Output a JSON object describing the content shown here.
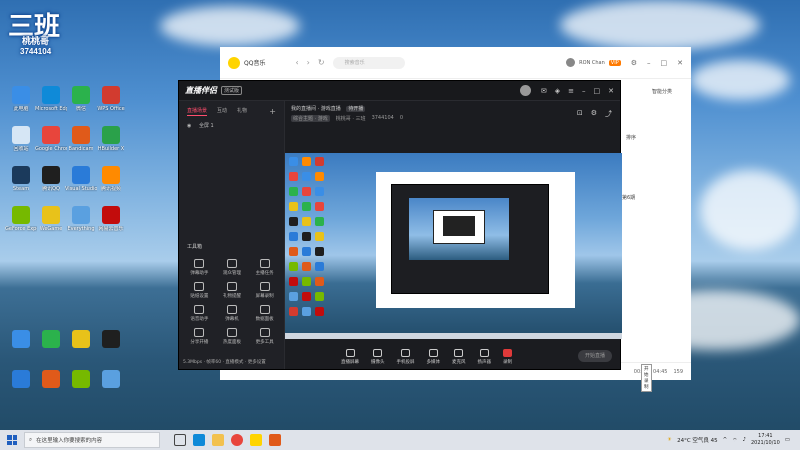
{
  "overlay": {
    "big": "三班",
    "name": "桃桃哥",
    "id": "3744104"
  },
  "desktop_icons": [
    {
      "label": "此电脑",
      "color": "#3a8ee6"
    },
    {
      "label": "回收站",
      "color": "#d6e6f5"
    },
    {
      "label": "Steam",
      "color": "#1b3a5c"
    },
    {
      "label": "GeForce Experience",
      "color": "#76b900"
    },
    {
      "label": "Microsoft Edge",
      "color": "#0f8ad8"
    },
    {
      "label": "Google Chrome",
      "color": "#e8453c"
    },
    {
      "label": "腾讯QQ",
      "color": "#1f1f1f"
    },
    {
      "label": "WeGame",
      "color": "#e8c21a"
    },
    {
      "label": "微信",
      "color": "#2bb24c"
    },
    {
      "label": "Bandicam",
      "color": "#e05a1a"
    },
    {
      "label": "Visual Studio Code",
      "color": "#2a7bd8"
    },
    {
      "label": "Everything",
      "color": "#5aa0e0"
    },
    {
      "label": "WPS Office",
      "color": "#d23b2f"
    },
    {
      "label": "HBuilder X",
      "color": "#2aa14a"
    },
    {
      "label": "腾讯视频",
      "color": "#ff8a00"
    },
    {
      "label": "网易云音乐",
      "color": "#c20c0c"
    }
  ],
  "qq_window": {
    "title": "QQ音乐",
    "search_placeholder": "搜索音乐",
    "user": "RON Chan",
    "badge": "VIP",
    "right_items": [
      "智能分类",
      "排序",
      "第6期"
    ],
    "bottom_time": "00:00 / 04:45",
    "bottom_count": "159"
  },
  "live_window": {
    "logo": "直播伴侣",
    "version": "测试版",
    "tabs": [
      "直播场景",
      "互动",
      "礼物"
    ],
    "scene_label": "全屏 1",
    "room_title": "我的直播间 · 游戏直播",
    "room_status": "待开播",
    "room_tag": "综合主题 · 游戏",
    "room_host": "桃桃哥 · 三班",
    "room_id": "3744104",
    "room_viewers": "0",
    "tools_title": "工具箱",
    "tools": [
      "弹幕助手",
      "观众管理",
      "主播任务",
      "贴纸设置",
      "礼物提醒",
      "屏幕录制",
      "语音助手",
      "弹幕机",
      "数据面板",
      "分享开播",
      "热度面板",
      "更多工具"
    ],
    "left_bottom": "5.3Mbps · 帧率60 · 直播模式 · 更多设置",
    "controls": [
      "直播屏幕",
      "摄像头",
      "手机投屏",
      "多媒体",
      "麦克风",
      "扬声器",
      "录制"
    ],
    "start_button": "开始直播",
    "tooltip": "开始录制"
  },
  "taskbar": {
    "search_placeholder": "在这里输入你要搜索的内容",
    "weather": "24°C 空气良 45",
    "time": "17:41",
    "date": "2021/10/10"
  }
}
